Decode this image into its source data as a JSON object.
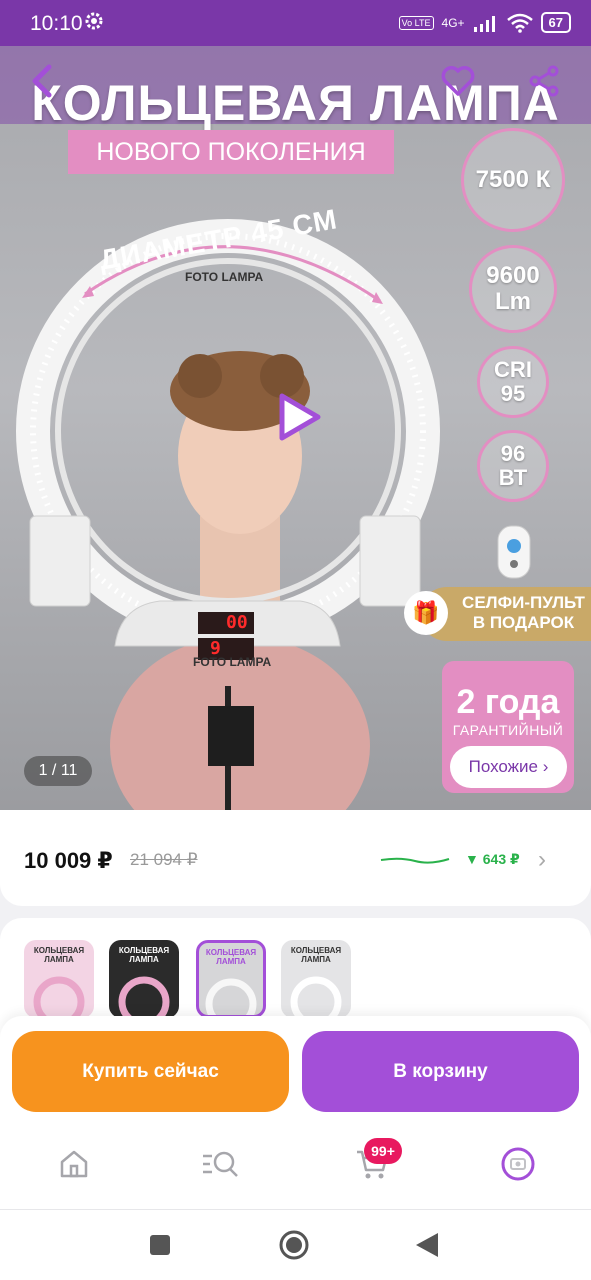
{
  "status_bar": {
    "time": "10:10",
    "network": "4G+",
    "volte": "Vo LTE",
    "battery": "67",
    "icons": [
      "gear-icon",
      "signal-icon",
      "wifi-icon",
      "battery-icon"
    ]
  },
  "hero": {
    "title": "КОЛЬЦЕВАЯ ЛАМПА",
    "subtitle": "НОВОГО ПОКОЛЕНИЯ",
    "diameter": "ДИАМЕТР 45 СМ",
    "specs": {
      "temp": "7500 К",
      "lm_value": "9600",
      "lm_unit": "Lm",
      "cri_label": "CRI",
      "cri_value": "95",
      "power_value": "96",
      "power_unit": "ВТ"
    },
    "gift_line1": "СЕЛФИ-ПУЛЬТ",
    "gift_line2": "В ПОДАРОК",
    "warranty_big": "2 года",
    "warranty_small": "ГАРАНТИЙНЫЙ",
    "similar_button": "Похожие ›",
    "counter": "1 / 11",
    "lamp_brand": "FOTO LAMPA",
    "lamp_display": "00",
    "lamp_display2": "9"
  },
  "price": {
    "current": "10 009 ₽",
    "old": "21 094 ₽",
    "diff": "▼ 643 ₽"
  },
  "thumbnails": {
    "count_active_index": 2,
    "labels": [
      "КОЛЬЦЕВАЯ ЛАМПА",
      "КОЛЬЦЕВАЯ ЛАМПА",
      "КОЛЬЦЕВАЯ ЛАМПА",
      "КОЛЬЦЕВАЯ ЛАМПА"
    ]
  },
  "actions": {
    "buy_now": "Купить сейчас",
    "add_to_cart": "В корзину"
  },
  "bottom_nav": {
    "cart_badge": "99+",
    "items": [
      "home-icon",
      "catalog-search-icon",
      "cart-icon",
      "profile-icon"
    ]
  },
  "colors": {
    "brand_purple": "#a34fd8",
    "status_bar": "#7a37a8",
    "pink": "#e38ec2",
    "orange": "#f7931e",
    "green": "#2ab24b",
    "badge_red": "#e8195f"
  }
}
